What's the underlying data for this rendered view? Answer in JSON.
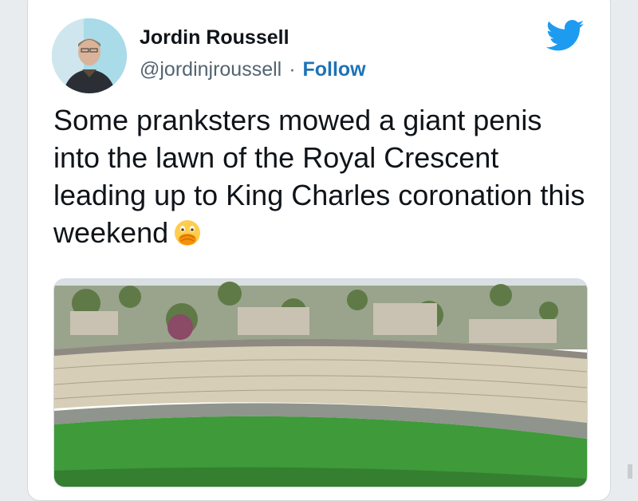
{
  "tweet": {
    "author_name": "Jordin Roussell",
    "handle": "@jordinjroussell",
    "separator": "·",
    "follow_label": "Follow",
    "text": "Some pranksters mowed a giant penis into the lawn of the Royal Crescent leading up to King Charles coronation this weekend",
    "emoji": "face-with-open-eyes-and-hand-over-mouth",
    "brand_icon": "twitter-bird-icon"
  },
  "colors": {
    "follow": "#1d73b8",
    "twitter_blue": "#1d9bf0",
    "name": "#0f1419",
    "secondary": "#536471"
  }
}
